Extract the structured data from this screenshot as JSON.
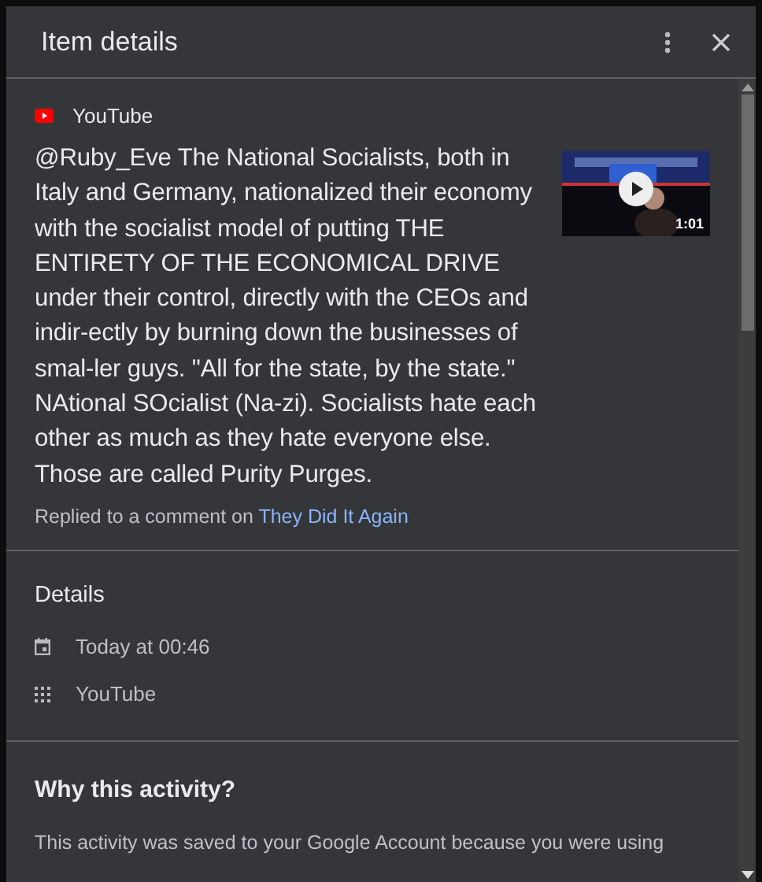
{
  "dialog": {
    "title": "Item details"
  },
  "item": {
    "source": "YouTube",
    "comment": "@Ruby_Eve The National Socialists, both in Italy and Germany, nationalized their economy with the socialist model of putting THE ENTIRETY OF THE ECONOMICAL DRIVE under their control, directly with the CEOs and indir-ectly by burning down the businesses of smal-ler guys. \"All for the state, by the state.\" NAtional SOcialist (Na-zi). Socialists hate each other as much as they hate everyone else. Those are called Purity Purges.",
    "video": {
      "kind": "picture",
      "duration": "1:01"
    },
    "reply_prefix": "Replied to a comment on",
    "reply_link": "They Did It Again"
  },
  "details": {
    "heading": "Details",
    "rows": [
      {
        "kind": "date",
        "text": "Today at 00:46"
      },
      {
        "kind": "product",
        "text": "YouTube"
      }
    ]
  },
  "why": {
    "heading": "Why this activity?",
    "text": "This activity was saved to your Google Account because you were using"
  }
}
